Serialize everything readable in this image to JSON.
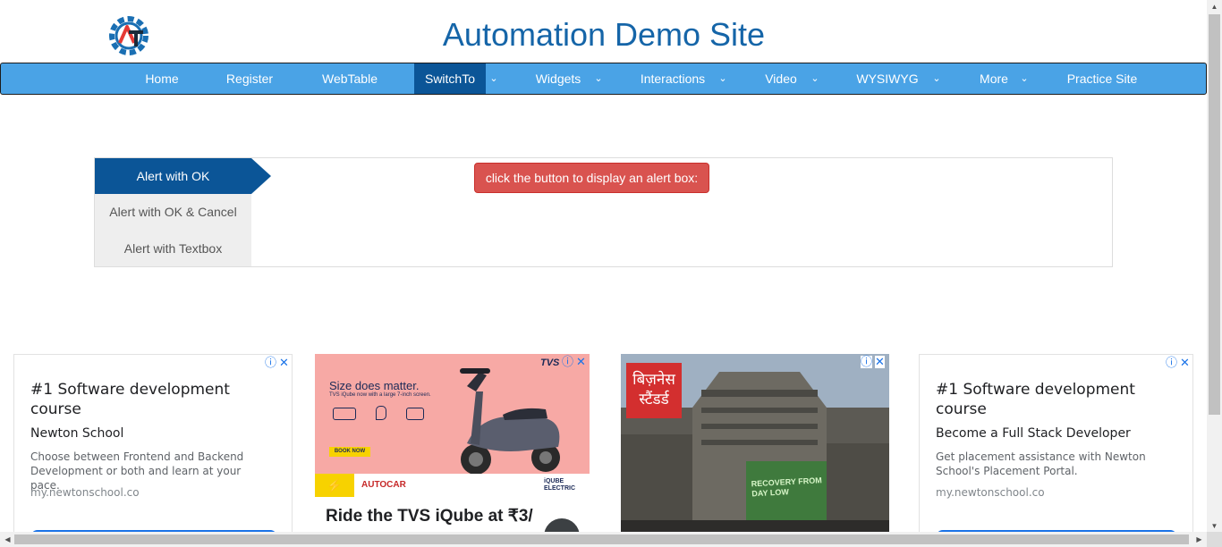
{
  "header": {
    "title": "Automation Demo Site",
    "logo_letters": "AT"
  },
  "nav": {
    "items": [
      {
        "label": "Home"
      },
      {
        "label": "Register"
      },
      {
        "label": "WebTable"
      },
      {
        "label": "SwitchTo",
        "active": true,
        "dropdown": true
      },
      {
        "label": "Widgets",
        "dropdown": true
      },
      {
        "label": "Interactions",
        "dropdown": true
      },
      {
        "label": "Video",
        "dropdown": true
      },
      {
        "label": "WYSIWYG",
        "dropdown": true
      },
      {
        "label": "More",
        "dropdown": true
      },
      {
        "label": "Practice Site"
      }
    ],
    "caret_glyph": "⌄",
    "colors": {
      "bar": "#4aa3e6",
      "active": "#0b5597"
    }
  },
  "alerts": {
    "tabs": [
      {
        "label": "Alert with OK",
        "active": true
      },
      {
        "label": "Alert with OK & Cancel"
      },
      {
        "label": "Alert with Textbox"
      }
    ],
    "button_label": "click the button to display an alert box:",
    "button_color": "#d9534f"
  },
  "ads": [
    {
      "type": "text",
      "headline": "#1 Software development course",
      "sponsor": "Newton School",
      "description": "Choose between Frontend and Backend Development or both and learn at your pace.",
      "url": "my.newtonschool.co"
    },
    {
      "type": "image",
      "brand": "TVS",
      "tagline": "Size does matter.",
      "subline": "TVS iQube now with a large 7-inch screen.",
      "button": "BOOK NOW",
      "partner": "AUTOCAR",
      "product_logo": "iQUBE ELECTRIC",
      "headline": "Ride the TVS iQube at ₹3/"
    },
    {
      "type": "image",
      "brand": "बिज़नेस स्टैंडर्ड",
      "banner_text": "RECOVERY FROM DAY LOW"
    },
    {
      "type": "text",
      "headline": "#1 Software development course",
      "sponsor": "Become a Full Stack Developer",
      "description": "Get placement assistance with Newton School's Placement Portal.",
      "url": "my.newtonschool.co"
    }
  ],
  "adchoices": {
    "info_glyph": "ⓘ",
    "close_glyph": "✕"
  }
}
